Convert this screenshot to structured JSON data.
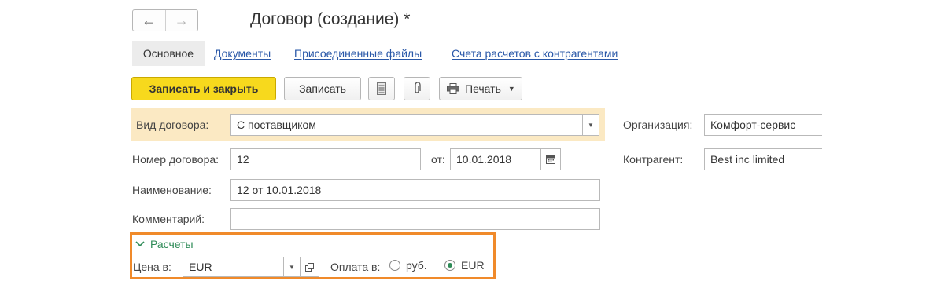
{
  "window": {
    "title": "Договор (создание) *",
    "nav_back": "←",
    "nav_forward": "→"
  },
  "tabs": [
    {
      "label": "Основное"
    },
    {
      "label": "Документы"
    },
    {
      "label": "Присоединенные файлы"
    },
    {
      "label": "Счета расчетов с контрагентами"
    }
  ],
  "toolbar": {
    "save_close_label": "Записать и закрыть",
    "save_label": "Записать",
    "print_label": "Печать"
  },
  "form": {
    "contract_type_label": "Вид договора:",
    "contract_type_value": "С поставщиком",
    "contract_number_label": "Номер договора:",
    "contract_number_value": "12",
    "date_label": "от:",
    "date_value": "10.01.2018",
    "name_label": "Наименование:",
    "name_value": "12 от 10.01.2018",
    "comment_label": "Комментарий:",
    "comment_value": "",
    "organization_label": "Организация:",
    "organization_value": "Комфорт-сервис",
    "counterparty_label": "Контрагент:",
    "counterparty_value": "Best inc limited"
  },
  "settlements": {
    "group_label": "Расчеты",
    "price_in_label": "Цена в:",
    "price_in_value": "EUR",
    "payment_in_label": "Оплата в:",
    "payment_options": [
      {
        "label": "руб.",
        "selected": false
      },
      {
        "label": "EUR",
        "selected": true
      }
    ]
  },
  "colors": {
    "primary_button": "#f7d91d",
    "highlight_row": "#fbe9c3",
    "link": "#2a58a8",
    "group_title": "#2e8b57",
    "callout_border": "#f08a2a"
  }
}
